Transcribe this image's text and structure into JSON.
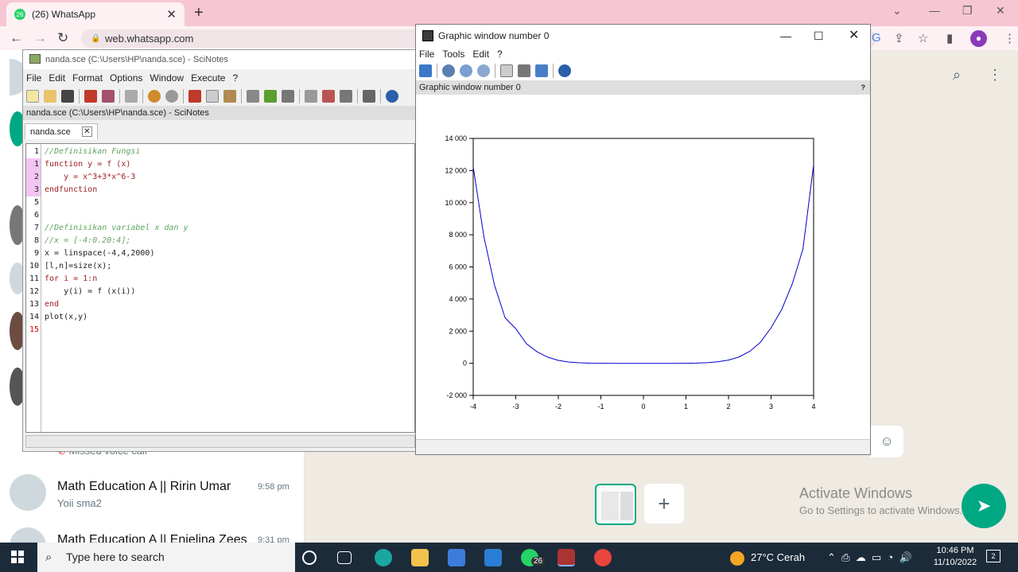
{
  "browser": {
    "tab_title": "(26) WhatsApp",
    "tab_favicon": "26",
    "url": "web.whatsapp.com"
  },
  "whatsapp": {
    "missed_call": "Missed voice call",
    "chats": [
      {
        "name": "Math Education A || Ririn Umar",
        "time": "9:58 pm",
        "preview": "Yoii sma2"
      },
      {
        "name": "Math Education A || Enjelina Zees",
        "time": "9:31 pm"
      }
    ],
    "activate_title": "Activate Windows",
    "activate_sub": "Go to Settings to activate Windows."
  },
  "scinotes": {
    "title": "nanda.sce (C:\\Users\\HP\\nanda.sce) - SciNotes",
    "menu": [
      "File",
      "Edit",
      "Format",
      "Options",
      "Window",
      "Execute",
      "?"
    ],
    "path": "nanda.sce (C:\\Users\\HP\\nanda.sce) - SciNotes",
    "tab": "nanda.sce",
    "line_numbers": [
      "1",
      "1",
      "2",
      "3",
      "5",
      "6",
      "7",
      "8",
      "9",
      "10",
      "11",
      "12",
      "13",
      "14",
      "15"
    ],
    "lines": [
      "//Definisikan Fungsi",
      "function y = f (x)",
      "    y = x^3+3*x^6-3",
      "endfunction",
      "",
      "",
      "//Definisikan variabel x dan y",
      "//x = [-4:0.20:4];",
      "x = linspace(-4,4,2000)",
      "[l,n]=size(x);",
      "for i = 1:n",
      "    y(i) = f (x(i))",
      "end",
      "plot(x,y)",
      ""
    ]
  },
  "graphic": {
    "title": "Graphic window number 0",
    "menu": [
      "File",
      "Tools",
      "Edit",
      "?"
    ],
    "info": "Graphic window number 0"
  },
  "chart_data": {
    "type": "line",
    "function": "y = x^3+3*x^6-3",
    "x_range": [
      -4,
      4
    ],
    "x_ticks": [
      "-4",
      "-3",
      "-2",
      "-1",
      "0",
      "1",
      "2",
      "3",
      "4"
    ],
    "y_ticks": [
      "-2 000",
      "0",
      "2 000",
      "4 000",
      "6 000",
      "8 000",
      "10 000",
      "12 000",
      "14 000"
    ],
    "xlim": [
      -4,
      4
    ],
    "ylim": [
      -2000,
      14000
    ],
    "series_color": "#0000cc",
    "points_x": [
      -4,
      -3.75,
      -3.5,
      -3.25,
      -3,
      -2.75,
      -2.5,
      -2.25,
      -2,
      -1.75,
      -1.5,
      -1.25,
      -1,
      -0.75,
      -0.5,
      -0.25,
      0,
      0.25,
      0.5,
      0.75,
      1,
      1.25,
      1.5,
      1.75,
      2,
      2.25,
      2.5,
      2.75,
      3,
      3.25,
      3.5,
      3.75,
      4
    ],
    "points_y": [
      12221,
      7894,
      4859,
      2832,
      2157,
      1221,
      714,
      385,
      181,
      77,
      30,
      8,
      2,
      -3,
      -3,
      -3,
      -3,
      -3,
      -3,
      -2,
      1,
      12,
      34,
      89,
      197,
      400,
      745,
      1303,
      2211,
      3349,
      4959,
      7117,
      12349
    ]
  },
  "taskbar": {
    "search_placeholder": "Type here to search",
    "weather": "27°C  Cerah",
    "time": "10:46 PM",
    "date": "11/10/2022",
    "notifications": "2",
    "whatsapp_badge": "26"
  }
}
